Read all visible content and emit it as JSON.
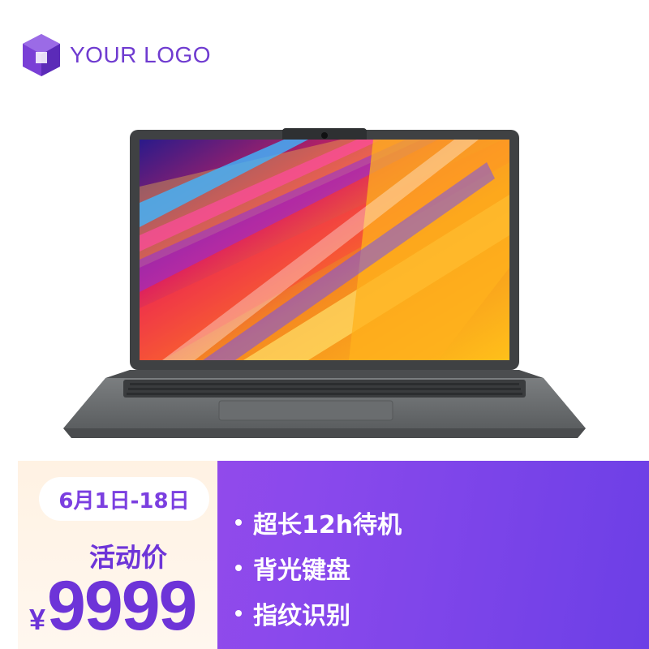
{
  "logo": {
    "text": "YOUR LOGO",
    "icon": "cube-logo-icon",
    "color": "#6f3bd0"
  },
  "product": {
    "image": "laptop-image"
  },
  "promo": {
    "date": "6月1日-18日",
    "label": "活动价",
    "currency": "¥",
    "price": "9999",
    "background": "#8a49ec",
    "accent": "#6d34d8"
  },
  "features": [
    {
      "text": "超长12h待机"
    },
    {
      "text": "背光键盘"
    },
    {
      "text": "指纹识别"
    }
  ]
}
